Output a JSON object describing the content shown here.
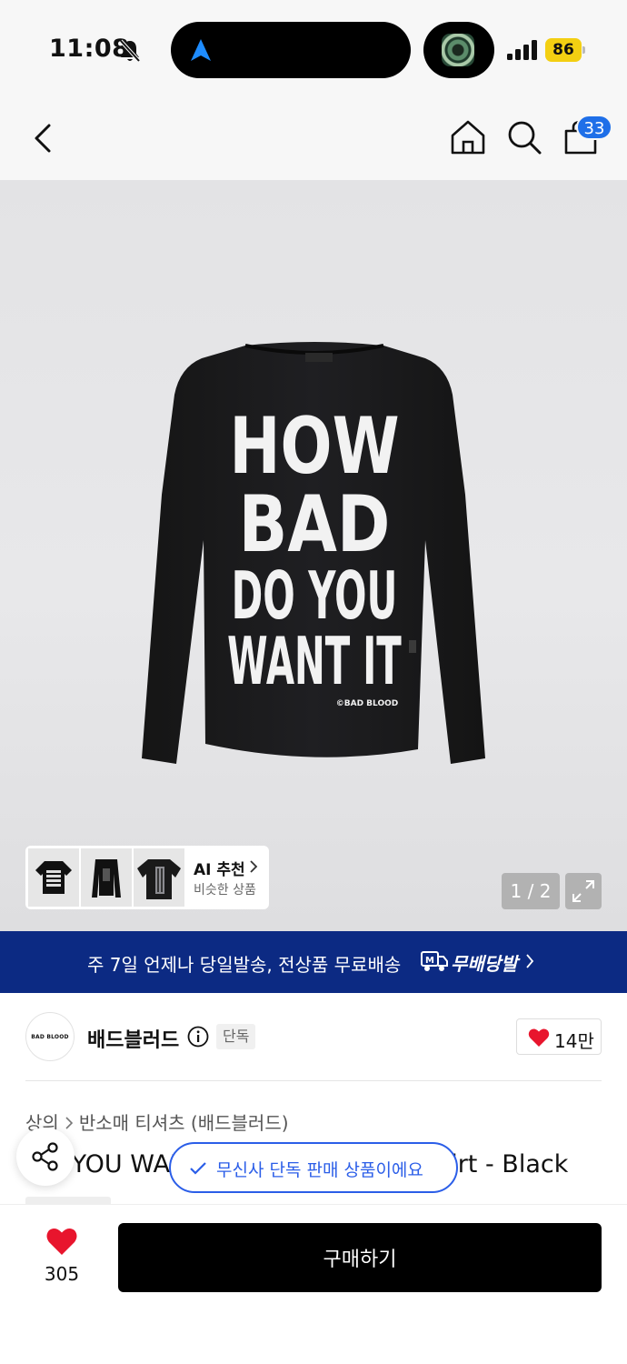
{
  "status_bar": {
    "time": "11:08",
    "battery": "86"
  },
  "header": {
    "cart_count": "33"
  },
  "hero": {
    "shirt_text_lines": [
      "HOW",
      "BAD",
      "DO YOU",
      "WANT IT"
    ],
    "shirt_small_print": "©BAD BLOOD",
    "ai_title": "AI 추천",
    "ai_subtitle": "비슷한 상품",
    "pager": "1 / 2"
  },
  "banner": {
    "text": "주 7일 언제나 당일발송, 전상품 무료배송",
    "brand": "무배당발"
  },
  "brand": {
    "logo_text": "BAD BLOOD",
    "name": "배드블러드",
    "exclusive_tag": "단독",
    "likes": "14만"
  },
  "product": {
    "breadcrumb": [
      "상의",
      "반소매 티셔츠 (배드블러드)"
    ],
    "title": "DO YOU WANT IT Long Sleeve T-Shirt - Black"
  },
  "toast": {
    "text": "무신사 단독 판매 상품이에요"
  },
  "bottom_bar": {
    "wishlist_count": "305",
    "buy_label": "구매하기"
  },
  "colors": {
    "banner": "#0c2a83",
    "accent_blue": "#2b5ee8",
    "heart_red": "#e8152d",
    "battery": "#f3cf12"
  }
}
